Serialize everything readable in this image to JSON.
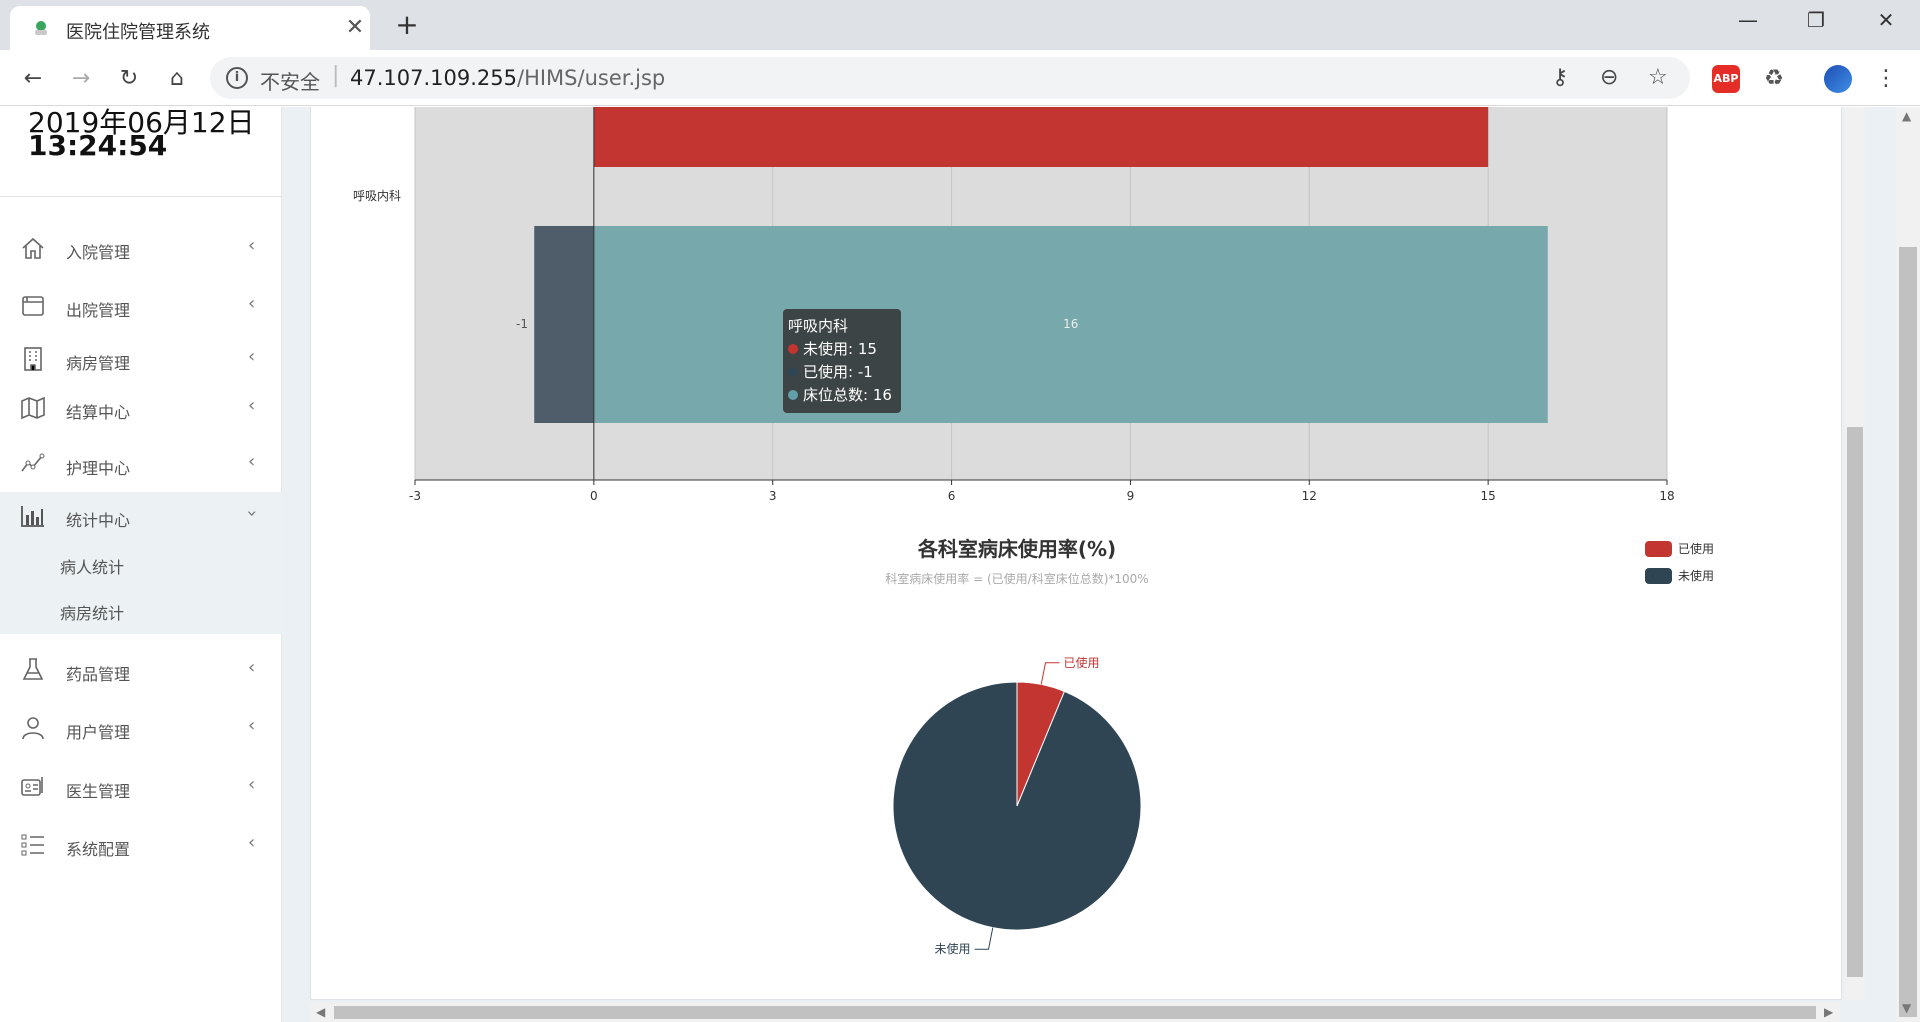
{
  "browser": {
    "tab_title": "医院住院管理系统",
    "insecure_label": "不安全",
    "url_host": "47.107.109.255",
    "url_path": "/HIMS/user.jsp",
    "new_tab": "+",
    "close_tab": "✕",
    "minimize": "—",
    "restore": "❐",
    "close_window": "✕",
    "abp_label": "ABP"
  },
  "clock": {
    "date": "2019年06月12日",
    "time": "13:24:54"
  },
  "sidebar": {
    "items": [
      {
        "label": "入院管理",
        "icon": "home-icon"
      },
      {
        "label": "出院管理",
        "icon": "window-icon"
      },
      {
        "label": "病房管理",
        "icon": "building-icon"
      },
      {
        "label": "结算中心",
        "icon": "map-icon"
      },
      {
        "label": "护理中心",
        "icon": "line-chart-icon"
      },
      {
        "label": "统计中心",
        "icon": "bar-chart-icon"
      },
      {
        "label": "药品管理",
        "icon": "flask-icon"
      },
      {
        "label": "用户管理",
        "icon": "user-icon"
      },
      {
        "label": "医生管理",
        "icon": "id-card-icon"
      },
      {
        "label": "系统配置",
        "icon": "list-icon"
      }
    ],
    "submenu": [
      {
        "label": "病人统计"
      },
      {
        "label": "病房统计"
      }
    ]
  },
  "chart_data": [
    {
      "type": "bar",
      "orientation": "horizontal",
      "categories": [
        "呼吸内科"
      ],
      "series": [
        {
          "name": "未使用",
          "values": [
            15
          ],
          "color": "#c23531"
        },
        {
          "name": "已使用",
          "values": [
            -1
          ],
          "color": "#2f4554"
        },
        {
          "name": "床位总数",
          "values": [
            16
          ],
          "color": "#61a0a8"
        }
      ],
      "xlim": [
        -3,
        18
      ],
      "xticks": [
        "-3",
        "0",
        "3",
        "6",
        "9",
        "12",
        "15",
        "18"
      ],
      "category_label": "呼吸内科",
      "data_labels": [
        "-1",
        "16"
      ],
      "tooltip": {
        "title": "呼吸内科",
        "rows": [
          "未使用: 15",
          "已使用: -1",
          "床位总数: 16"
        ]
      }
    },
    {
      "type": "pie",
      "title": "各科室病床使用率(%)",
      "subtitle": "科室病床使用率 = (已使用/科室床位总数)*100%",
      "legend": [
        "已使用",
        "未使用"
      ],
      "legend_position": "top-right",
      "slices": [
        {
          "name": "已使用",
          "value": 6.25,
          "color": "#c23531"
        },
        {
          "name": "未使用",
          "value": 93.75,
          "color": "#2f4554"
        }
      ]
    }
  ]
}
